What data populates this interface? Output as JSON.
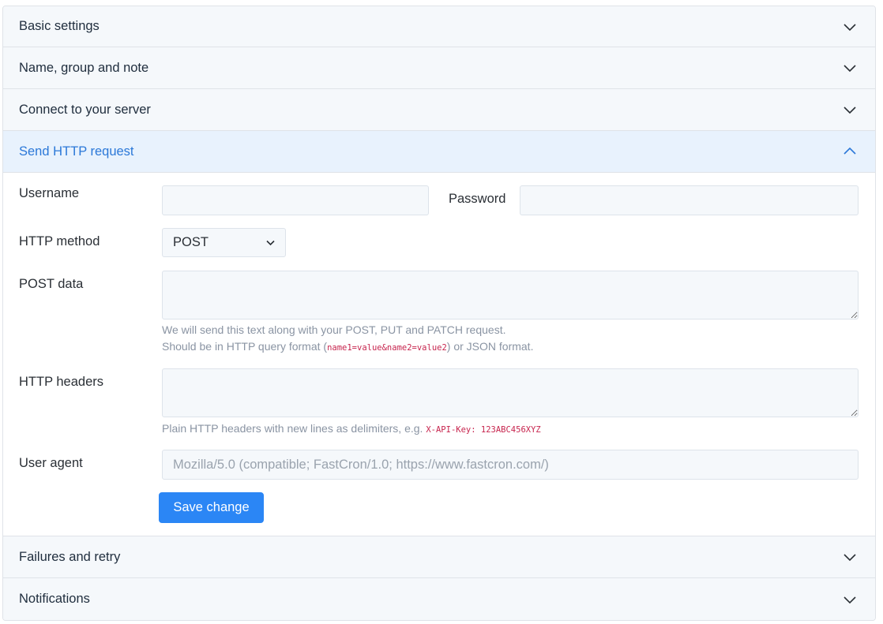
{
  "sections": {
    "basic": "Basic settings",
    "name_group": "Name, group and note",
    "connect": "Connect to your server",
    "http": "Send HTTP request",
    "failures": "Failures and retry",
    "notifications": "Notifications"
  },
  "form": {
    "username_label": "Username",
    "username_value": "",
    "password_label": "Password",
    "password_value": "",
    "method_label": "HTTP method",
    "method_value": "POST",
    "post_data_label": "POST data",
    "post_data_value": "",
    "post_help_line1": "We will send this text along with your POST, PUT and PATCH request.",
    "post_help_line2_pre": "Should be in HTTP query format (",
    "post_help_code": "name1=value&name2=value2",
    "post_help_line2_post": ") or JSON format.",
    "headers_label": "HTTP headers",
    "headers_value": "",
    "headers_help_pre": "Plain HTTP headers with new lines as delimiters, e.g. ",
    "headers_help_code": "X-API-Key: 123ABC456XYZ",
    "ua_label": "User agent",
    "ua_placeholder": "Mozilla/5.0 (compatible; FastCron/1.0; https://www.fastcron.com/)",
    "save_label": "Save change"
  },
  "icons": {
    "collapsed": "chevron-down-icon",
    "expanded": "chevron-up-icon",
    "select": "chevron-down-icon"
  },
  "colors": {
    "accent": "#2b86f5",
    "active_title": "#2b78d8",
    "active_header_bg": "#e8f2fd",
    "header_bg": "#f5f8fb",
    "code": "#c7254e"
  }
}
